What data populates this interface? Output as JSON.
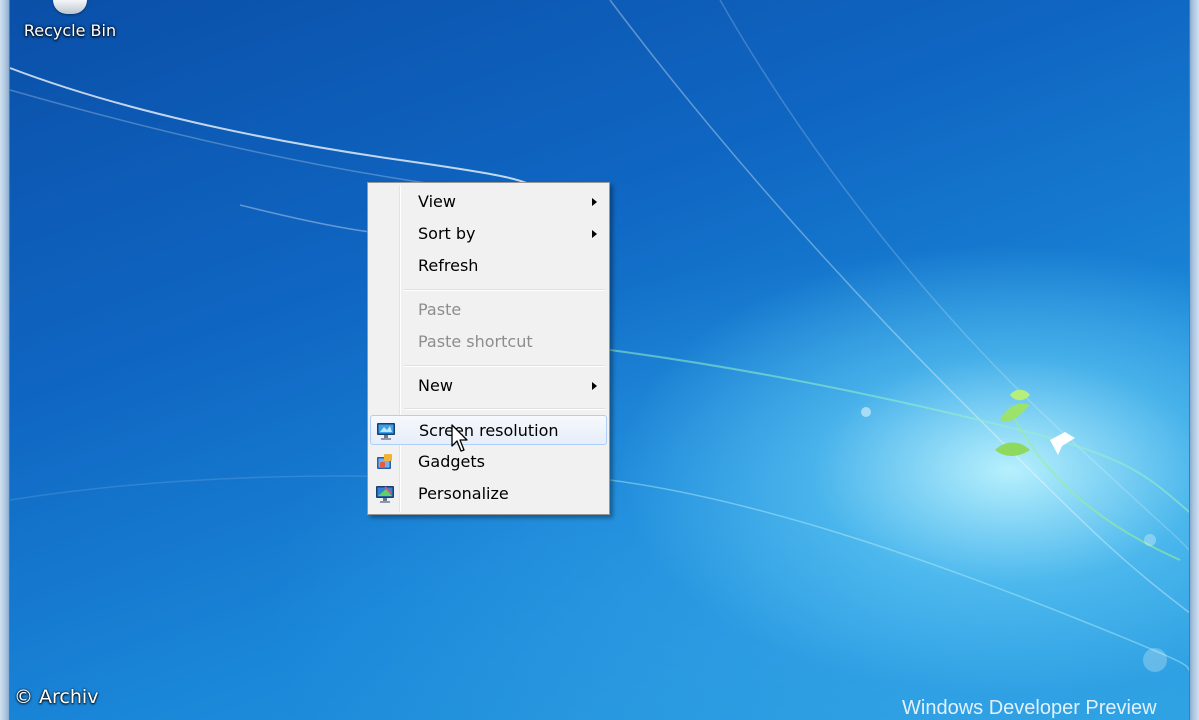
{
  "desktop": {
    "recycle_bin_label": "Recycle Bin",
    "watermark": "© Archiv",
    "brand_text": "Windows Developer Preview"
  },
  "context_menu": {
    "items": [
      {
        "label": "View",
        "has_submenu": true,
        "enabled": true
      },
      {
        "label": "Sort by",
        "has_submenu": true,
        "enabled": true
      },
      {
        "label": "Refresh",
        "has_submenu": false,
        "enabled": true
      },
      {
        "label": "Paste",
        "has_submenu": false,
        "enabled": false
      },
      {
        "label": "Paste shortcut",
        "has_submenu": false,
        "enabled": false
      },
      {
        "label": "New",
        "has_submenu": true,
        "enabled": true
      },
      {
        "label": "Screen resolution",
        "has_submenu": false,
        "enabled": true,
        "icon": "monitor-icon",
        "hovered": true
      },
      {
        "label": "Gadgets",
        "has_submenu": false,
        "enabled": true,
        "icon": "gadgets-icon"
      },
      {
        "label": "Personalize",
        "has_submenu": false,
        "enabled": true,
        "icon": "personalize-icon"
      }
    ]
  },
  "colors": {
    "menu_background": "#f1f1f1",
    "hover_border": "#aecff7",
    "disabled_text": "#8d8d8d"
  }
}
